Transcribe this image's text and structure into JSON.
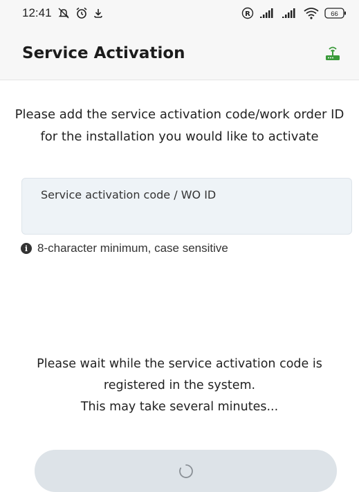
{
  "status_bar": {
    "time": "12:41",
    "battery": "66"
  },
  "app_bar": {
    "title": "Service Activation"
  },
  "instruction": {
    "line1": "Please add the service activation code/work order ID",
    "line2": "for the installation you would like to activate"
  },
  "field": {
    "label": "Service activation code / WO ID",
    "value": ""
  },
  "hint": {
    "text": "8-character minimum, case sensitive"
  },
  "wait_message": {
    "line1": "Please wait while the service activation code is",
    "line2": "registered in the system.",
    "line3": "This may take several minutes..."
  },
  "colors": {
    "router_icon": "#3a9a3a",
    "field_bg": "#eef3f7",
    "button_bg": "#dde3e8"
  },
  "icons": [
    "mute-icon",
    "alarm-icon",
    "download-icon",
    "registered-icon",
    "signal-icon",
    "wifi-icon",
    "battery-icon",
    "router-icon",
    "info-icon",
    "spinner-icon"
  ]
}
